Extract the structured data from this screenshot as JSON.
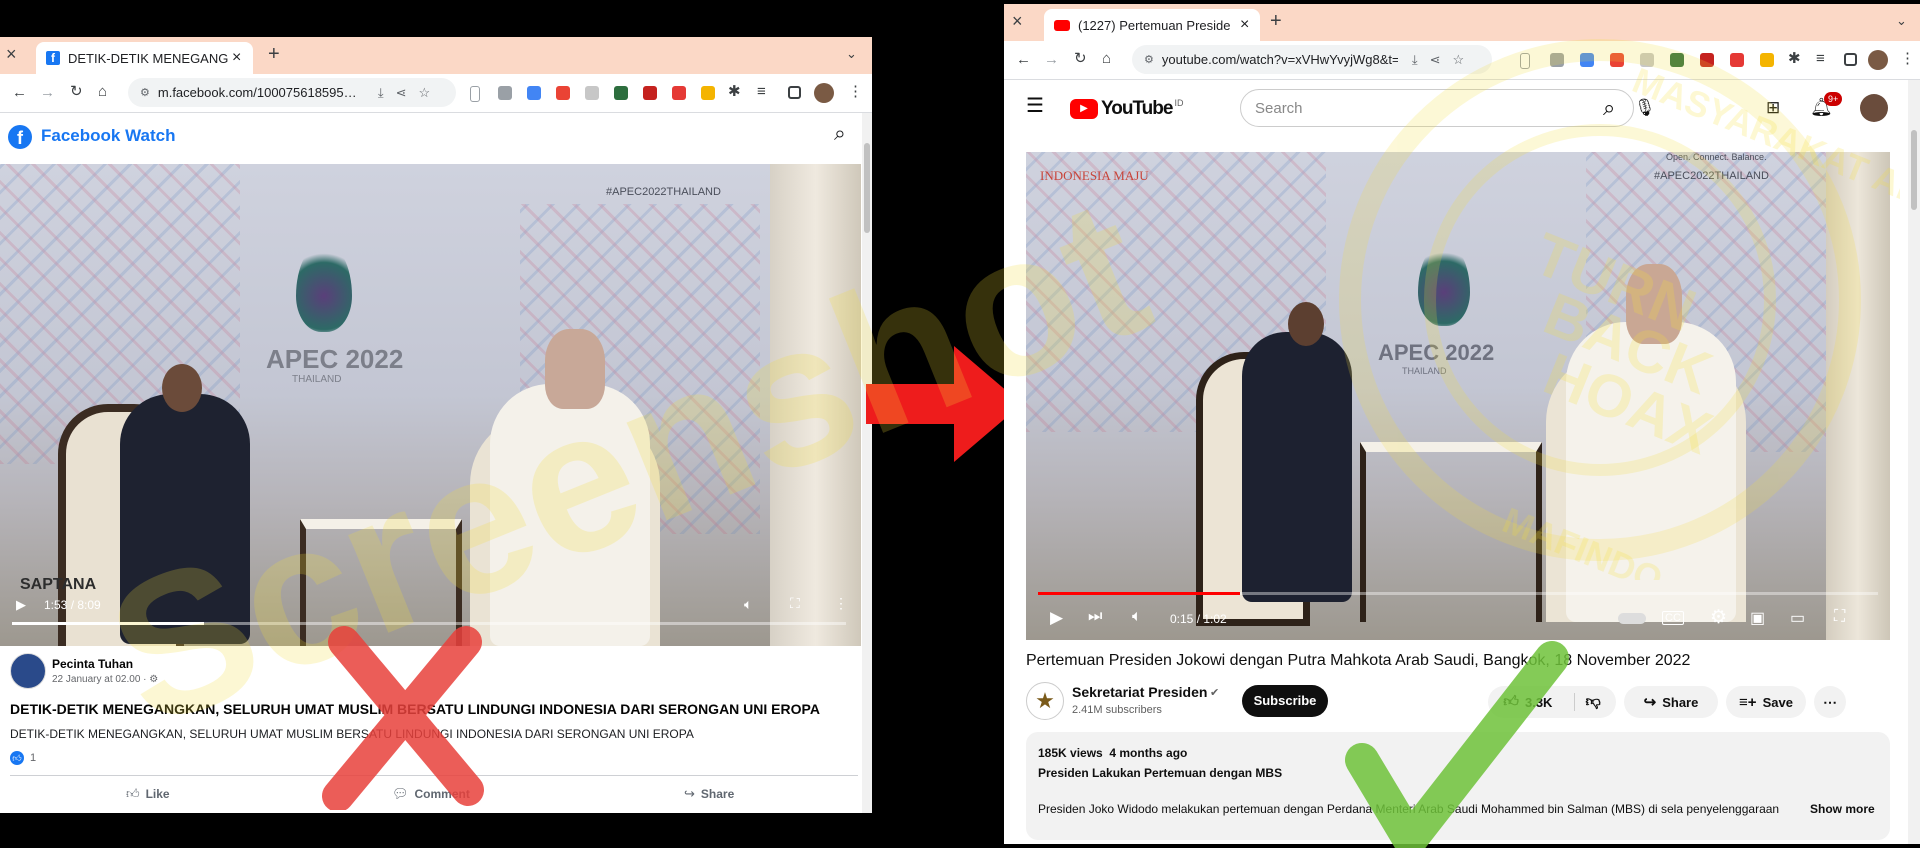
{
  "left": {
    "tab": {
      "title": "DETIK-DETIK MENEGANGKAN",
      "close": "×",
      "new": "+"
    },
    "window_close": "×",
    "url": "m.facebook.com/100075618595…",
    "header_title": "Facebook Watch",
    "watermark_corner": "#APEC2022THAILAND",
    "video_text_apec": "APEC 2022",
    "video_text_thailand": "THAILAND",
    "video_corner": "SAPTANA",
    "time": "1:53 / 8:09",
    "progress": 0.23,
    "author": "Pecinta Tuhan",
    "date": "22 January at 02.00 · ⚙",
    "post_title": "DETIK-DETIK MENEGANGKAN, SELURUH UMAT MUSLIM BERSATU LINDUNGI INDONESIA DARI SERONGAN UNI EROPA",
    "post_body": "DETIK-DETIK MENEGANGKAN, SELURUH UMAT MUSLIM BERSATU LINDUNGI INDONESIA DARI SERONGAN UNI EROPA",
    "likes": "1",
    "actions": {
      "like": "Like",
      "comment": "Comment",
      "share": "Share"
    }
  },
  "right": {
    "tab": {
      "title": "(1227) Pertemuan Preside",
      "close": "×",
      "new": "+"
    },
    "window_close": "×",
    "url": "youtube.com/watch?v=xVHwYvyjWg8&t=1…",
    "logo_text": "YouTube",
    "logo_region": "ID",
    "search_placeholder": "Search",
    "notif_badge": "9+",
    "video_corner": "INDONESIA MAJU",
    "watermark_corner": "#APEC2022THAILAND",
    "watermark_top": "Open. Connect. Balance.",
    "video_text_apec": "APEC 2022",
    "video_text_thailand": "THAILAND",
    "time": "0:15 / 1:02",
    "progress": 0.24,
    "video_title": "Pertemuan Presiden Jokowi dengan Putra Mahkota Arab Saudi, Bangkok, 18 November 2022",
    "channel": "Sekretariat Presiden",
    "subscribers": "2.41M subscribers",
    "subscribe": "Subscribe",
    "like_count": "3.3K",
    "share": "Share",
    "save": "Save",
    "views": "185K views  4 months ago",
    "desc_title": "Presiden Lakukan Pertemuan dengan MBS",
    "desc_text": "Presiden Joko Widodo melakukan pertemuan dengan Perdana Menteri Arab Saudi Mohammed bin Salman (MBS) di sela penyelenggaraan",
    "show_more": "Show more"
  },
  "overlay": {
    "watermark": "Screenshot",
    "stamp_lines": [
      "MASYARAKAT ANTI FITNAH INDONESIA",
      "TURN",
      "BACK",
      "HOAX",
      "MAFINDO"
    ]
  },
  "colors": {
    "facebook_blue": "#1877f2",
    "youtube_red": "#ff0000",
    "arrow_red": "#ee1c1c",
    "cross_red": "#e8413c",
    "check_green": "#6ec23a",
    "watermark_yellow": "#f3de3a"
  }
}
